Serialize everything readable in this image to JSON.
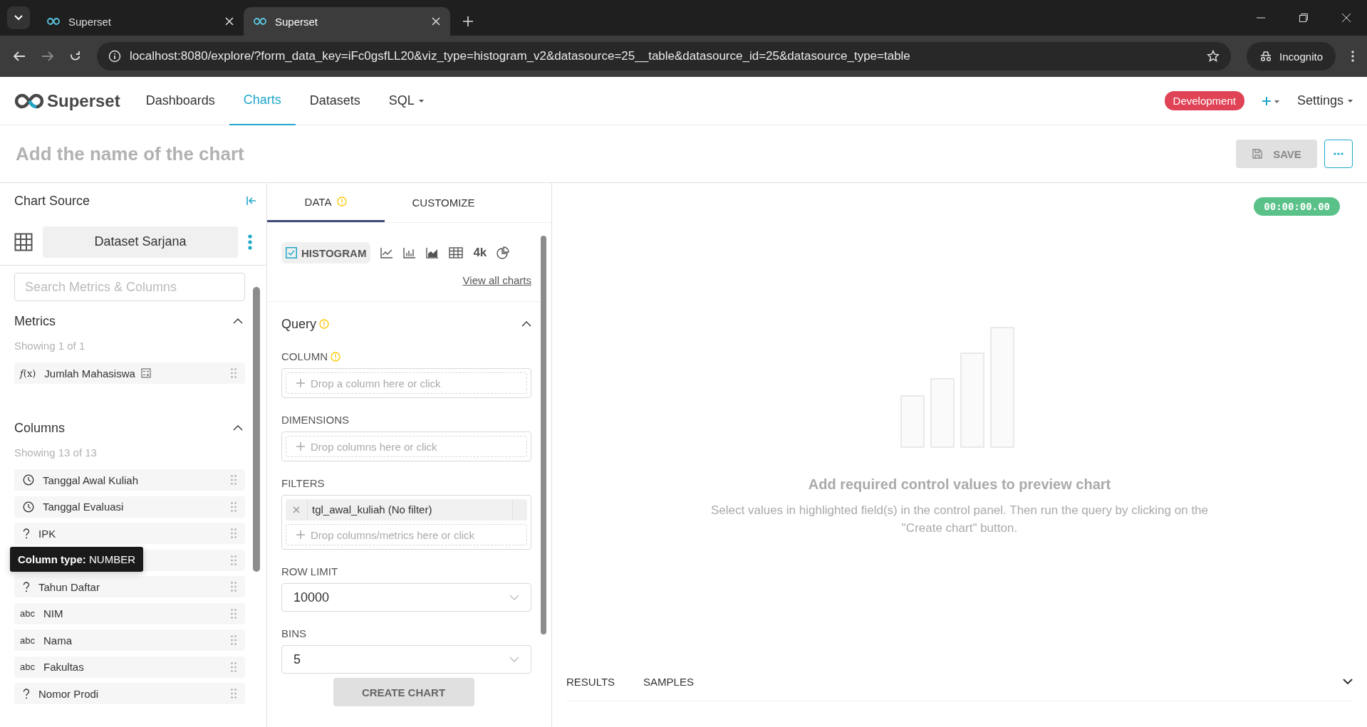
{
  "browser": {
    "tabs": [
      {
        "title": "Superset",
        "selected": false
      },
      {
        "title": "Superset",
        "selected": true
      }
    ],
    "url": "localhost:8080/explore/?form_data_key=iFc0gsfLL20&viz_type=histogram_v2&datasource=25__table&datasource_id=25&datasource_type=table",
    "profile": "Incognito"
  },
  "navbar": {
    "brand": "Superset",
    "items": [
      {
        "label": "Dashboards",
        "selected": false,
        "kind": "link"
      },
      {
        "label": "Charts",
        "selected": true,
        "kind": "link"
      },
      {
        "label": "Datasets",
        "selected": false,
        "kind": "link"
      },
      {
        "label": "SQL",
        "selected": false,
        "kind": "menu"
      }
    ],
    "env_badge": "Development",
    "settings": "Settings"
  },
  "title_bar": {
    "placeholder": "Add the name of the chart",
    "save": "SAVE"
  },
  "datasource": {
    "heading": "Chart Source",
    "dataset": "Dataset Sarjana",
    "search_placeholder": "Search Metrics & Columns",
    "metrics": {
      "title": "Metrics",
      "expanded": true,
      "count": "Showing 1 of 1",
      "items": [
        {
          "name": "Jumlah Mahasiswa",
          "kind": "metric",
          "type_label": "*f*(x)"
        }
      ]
    },
    "columns": {
      "title": "Columns",
      "expanded": true,
      "count": "Showing 13 of 13",
      "items": [
        {
          "name": "Tanggal Awal Kuliah",
          "kind": "time"
        },
        {
          "name": "Tanggal Evaluasi",
          "kind": "time"
        },
        {
          "name": "IPK",
          "kind": "number"
        },
        {
          "kind": "covered"
        },
        {
          "name": "Tahun Daftar",
          "kind": "number"
        },
        {
          "name": "NIM",
          "kind": "string",
          "type_label": "abc"
        },
        {
          "name": "Nama",
          "kind": "string",
          "type_label": "abc"
        },
        {
          "name": "Fakultas",
          "kind": "string",
          "type_label": "abc"
        },
        {
          "name": "Nomor Prodi",
          "kind": "number"
        }
      ]
    },
    "tooltip": "**Column type:** NUMBER"
  },
  "control_panel": {
    "tabs": [
      {
        "label": "DATA",
        "selected": true,
        "warning": true
      },
      {
        "label": "CUSTOMIZE",
        "selected": false,
        "warning": false
      }
    ],
    "chart_types": [
      {
        "kind": "histogram",
        "label": "HISTOGRAM",
        "selected": true
      },
      {
        "kind": "line",
        "selected": false
      },
      {
        "kind": "bar",
        "selected": false
      },
      {
        "kind": "area",
        "selected": false
      },
      {
        "kind": "table",
        "selected": false
      },
      {
        "kind": "big_number",
        "label": "4k",
        "selected": false
      },
      {
        "kind": "pie",
        "selected": false
      }
    ],
    "view_all": "View all charts",
    "section": {
      "title": "Query",
      "warning": true,
      "expanded": true
    },
    "controls": [
      {
        "kind": "drop",
        "label": "COLUMN",
        "warning": true,
        "hint": "Drop a column here or click"
      },
      {
        "kind": "drop",
        "label": "DIMENSIONS",
        "warning": false,
        "hint": "Drop columns here or click"
      },
      {
        "kind": "filters",
        "label": "FILTERS",
        "warning": false,
        "chips": [
          "tgl_awal_kuliah (No filter)"
        ],
        "hint": "Drop columns/metrics here or click"
      },
      {
        "kind": "select",
        "label": "ROW LIMIT",
        "warning": false,
        "value": "10000"
      },
      {
        "kind": "select",
        "label": "BINS",
        "warning": false,
        "value": "5"
      }
    ],
    "create_button": "CREATE CHART"
  },
  "chart_area": {
    "timer": "00:00:00.00",
    "empty_title": "Add required control values to preview chart",
    "empty_text": "Select values in highlighted field(s) in the control panel. Then run the query by clicking on the \"Create chart\" button.",
    "bottom_tabs": [
      {
        "label": "RESULTS"
      },
      {
        "label": "SAMPLES"
      }
    ]
  }
}
